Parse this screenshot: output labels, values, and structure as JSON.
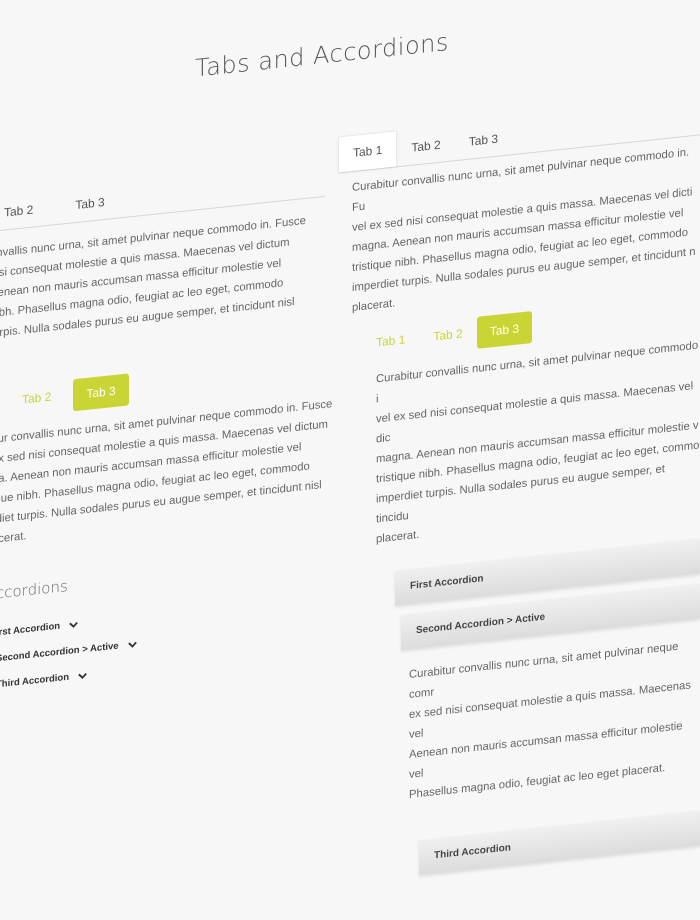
{
  "page_title": "Tabs and Accordions",
  "tabs_plain_left": {
    "tabs": [
      "Tab 2",
      "Tab 3"
    ],
    "lines": [
      "onvallis nunc urna, sit amet pulvinar neque commodo in. Fusce",
      "nisi consequat molestie a quis massa. Maecenas vel dictum",
      "Aenean non mauris accumsan massa efficitur molestie vel",
      "nibh. Phasellus magna odio, feugiat ac leo eget, commodo",
      "turpis. Nulla sodales purus eu augue semper, et tincidunt nisl",
      "."
    ]
  },
  "tabs_plain_right": {
    "tabs": [
      "Tab 1",
      "Tab 2",
      "Tab 3"
    ],
    "lines": [
      "Curabitur convallis nunc urna, sit amet pulvinar neque commodo in. Fu",
      "vel ex sed nisi consequat molestie a quis massa. Maecenas vel dicti",
      "magna. Aenean non mauris accumsan massa efficitur molestie vel",
      "tristique nibh. Phasellus magna odio, feugiat ac leo eget, commodo",
      "imperdiet turpis. Nulla sodales purus eu augue semper, et tincidunt n",
      "placerat."
    ]
  },
  "tabs_lime_left": {
    "tabs": [
      "Tab 2",
      "Tab 3"
    ],
    "lines": [
      "itur convallis nunc urna, sit amet pulvinar neque commodo in. Fusce",
      "ex sed nisi consequat molestie a quis massa. Maecenas vel dictum",
      "na. Aenean non mauris accumsan massa efficitur molestie vel",
      "ique nibh. Phasellus magna odio, feugiat ac leo eget, commodo",
      "rdiet turpis. Nulla sodales purus eu augue semper, et tincidunt nisl",
      "acerat."
    ]
  },
  "tabs_lime_right": {
    "tabs": [
      "Tab 1",
      "Tab 2",
      "Tab 3"
    ],
    "lines": [
      "Curabitur convallis nunc urna, sit amet pulvinar neque commodo i",
      "vel ex sed nisi consequat molestie a quis massa. Maecenas vel dic",
      "magna. Aenean non mauris accumsan massa efficitur molestie v",
      "tristique nibh. Phasellus magna odio, feugiat ac leo eget, commo",
      "imperdiet turpis. Nulla sodales purus eu augue semper, et tincidu",
      "placerat."
    ]
  },
  "accordions_left": {
    "heading": "ccordions",
    "items": [
      "irst Accordion",
      "Second Accordion > Active",
      "Third Accordion"
    ]
  },
  "accordions_right": {
    "items": [
      "First Accordion",
      "Second Accordion > Active",
      "Third Accordion"
    ],
    "lines": [
      "Curabitur convallis nunc urna, sit amet pulvinar neque comr",
      "ex sed nisi consequat molestie a quis massa. Maecenas vel",
      "Aenean non mauris accumsan massa efficitur molestie vel",
      "Phasellus magna odio, feugiat ac leo eget placerat."
    ]
  },
  "colors": {
    "accent": "#c9d534"
  }
}
